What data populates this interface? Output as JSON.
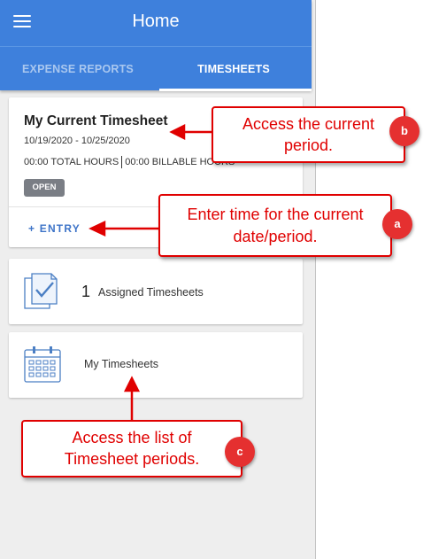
{
  "header": {
    "title": "Home",
    "tabs": [
      {
        "label": "EXPENSE REPORTS",
        "active": false
      },
      {
        "label": "TIMESHEETS",
        "active": true
      }
    ],
    "color": "#3e80dc"
  },
  "current_timesheet": {
    "title": "My Current Timesheet",
    "dates": "10/19/2020 - 10/25/2020",
    "total_hours": "00:00 TOTAL HOURS",
    "billable_hours": "00:00 BILLABLE HOURS",
    "status": "OPEN",
    "entry_label": "+ ENTRY"
  },
  "assigned": {
    "count": "1",
    "label": "Assigned Timesheets",
    "icon": "documents-check-icon"
  },
  "my_timesheets": {
    "label": "My Timesheets",
    "icon": "calendar-icon"
  },
  "callouts": {
    "b": {
      "line1": "Access the current",
      "line2": "period.",
      "marker": "b"
    },
    "a": {
      "line1": "Enter time for the current",
      "line2": "date/period.",
      "marker": "a"
    },
    "c": {
      "line1": "Access the list of",
      "line2": "Timesheet periods.",
      "marker": "c"
    },
    "color": "#e00000"
  }
}
